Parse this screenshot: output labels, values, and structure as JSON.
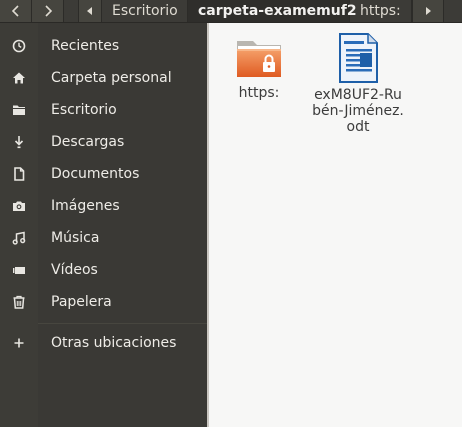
{
  "header": {
    "path": [
      {
        "label": "Escritorio",
        "active": false
      },
      {
        "label": "carpeta-examemuf2",
        "active": true
      },
      {
        "label": "https:",
        "active": false
      }
    ]
  },
  "sidebar": {
    "items": [
      {
        "label": "Recientes",
        "icon": "clock-icon"
      },
      {
        "label": "Carpeta personal",
        "icon": "home-icon"
      },
      {
        "label": "Escritorio",
        "icon": "folder-icon"
      },
      {
        "label": "Descargas",
        "icon": "download-icon"
      },
      {
        "label": "Documentos",
        "icon": "document-icon"
      },
      {
        "label": "Imágenes",
        "icon": "camera-icon"
      },
      {
        "label": "Música",
        "icon": "music-icon"
      },
      {
        "label": "Vídeos",
        "icon": "video-icon"
      },
      {
        "label": "Papelera",
        "icon": "trash-icon"
      },
      {
        "label": "Otras ubicaciones",
        "icon": "plus-icon"
      }
    ]
  },
  "files": [
    {
      "name": "https:",
      "icon": "locked-folder-icon"
    },
    {
      "name": "exM8UF2-Rubén-Jiménez.odt",
      "icon": "odt-document-icon"
    }
  ]
}
